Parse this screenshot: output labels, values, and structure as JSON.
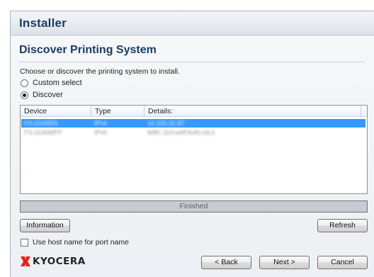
{
  "window": {
    "title": "Installer"
  },
  "page": {
    "heading": "Discover Printing System",
    "instruction": "Choose or discover the printing system to install."
  },
  "options": {
    "custom_select": {
      "label": "Custom select",
      "selected": false
    },
    "discover": {
      "label": "Discover",
      "selected": true
    }
  },
  "device_list": {
    "columns": [
      "Device",
      "Type",
      "Details:"
    ],
    "rows": [
      {
        "device": "FS-2100DN",
        "type": "IPv4",
        "details": "10.100.32.87",
        "selected": true
      },
      {
        "device": "FS-3140MFP",
        "type": "IPv6",
        "details": "fe80::2c0:eeff:fe45:c6c1",
        "selected": false
      }
    ]
  },
  "progress": {
    "status": "Finished",
    "fraction": 1.0
  },
  "buttons": {
    "information": "Information",
    "refresh": "Refresh",
    "back": "< Back",
    "next": "Next >",
    "cancel": "Cancel"
  },
  "host_name_option": {
    "label": "Use host name for port name",
    "checked": false
  },
  "brand": {
    "name": "KYOCERA",
    "color": "#e2231a"
  }
}
